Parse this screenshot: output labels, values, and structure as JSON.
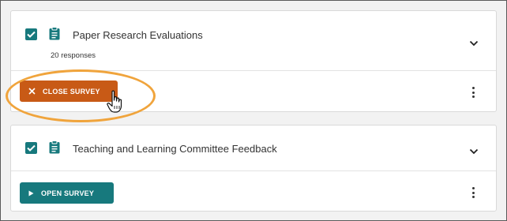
{
  "surveys": [
    {
      "title": "Paper Research Evaluations",
      "responses": "20 responses",
      "checked": true,
      "action_label": "CLOSE SURVEY",
      "action_icon": "close-icon"
    },
    {
      "title": "Teaching and Learning Committee Feedback",
      "checked": true,
      "action_label": "OPEN SURVEY",
      "action_icon": "play-icon"
    }
  ],
  "colors": {
    "teal": "#17797d",
    "orange_button": "#c85a16",
    "highlight_ring": "#f0a43c"
  },
  "icons": [
    "checkbox-checked-icon",
    "clipboard-icon",
    "chevron-down-icon",
    "close-icon",
    "play-icon",
    "kebab-menu-icon",
    "hand-pointer-cursor"
  ]
}
